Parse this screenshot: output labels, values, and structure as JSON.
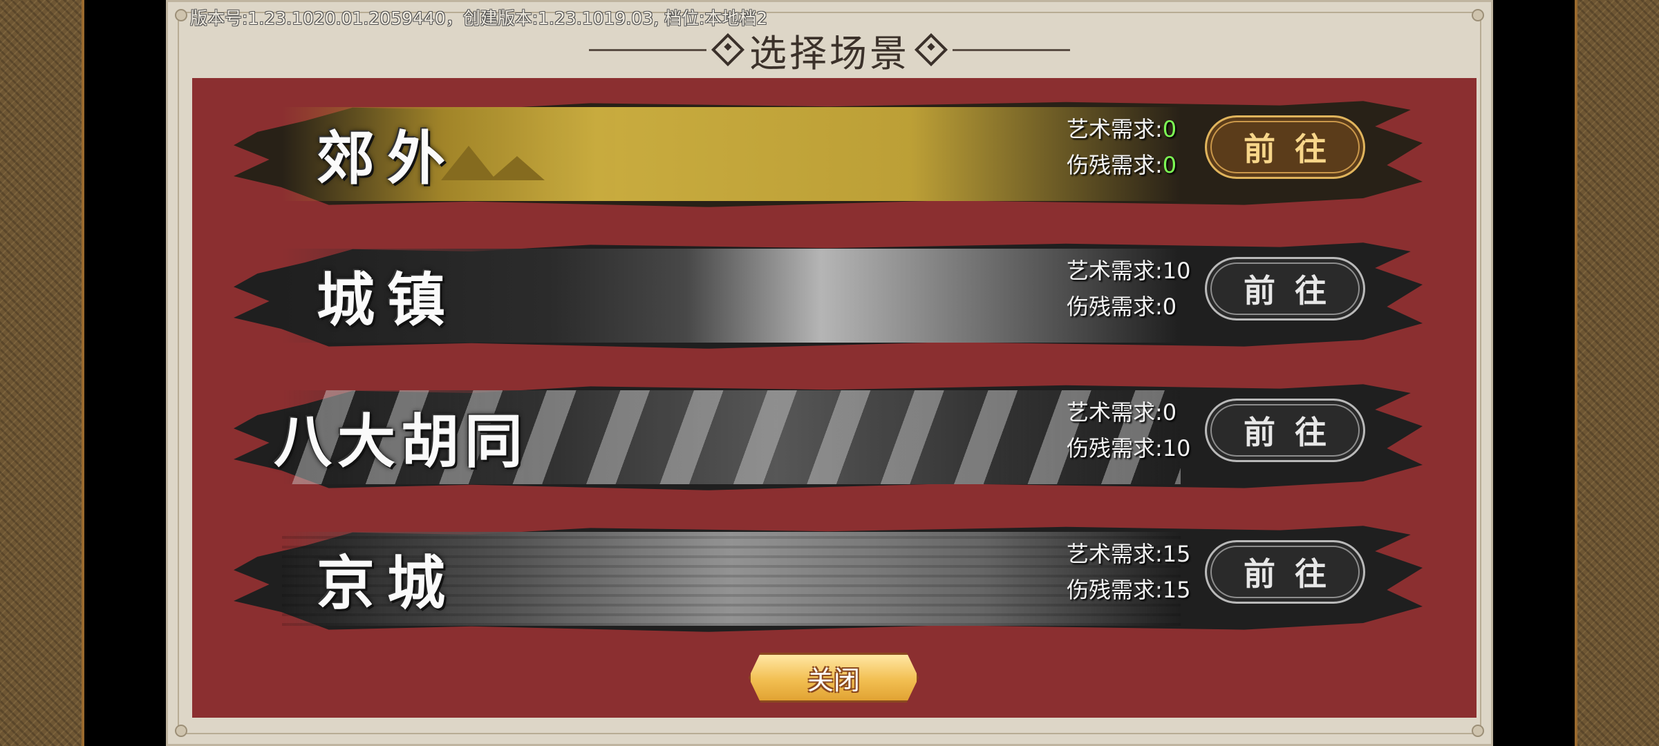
{
  "version_info": "版本号:1.23.1020.01.2059440，创建版本:1.23.1019.03, 档位:本地档2",
  "dialog": {
    "title": "选择场景",
    "close_label": "关闭"
  },
  "requirement_labels": {
    "art": "艺术需求:",
    "injury": "伤残需求:"
  },
  "scenes": [
    {
      "name": "郊外",
      "art_req": "0",
      "injury_req": "0",
      "go_label": "前往",
      "unlocked": true
    },
    {
      "name": "城镇",
      "art_req": "10",
      "injury_req": "0",
      "go_label": "前往",
      "unlocked": false
    },
    {
      "name": "八大胡同",
      "art_req": "0",
      "injury_req": "10",
      "go_label": "前往",
      "unlocked": false
    },
    {
      "name": "京城",
      "art_req": "15",
      "injury_req": "15",
      "go_label": "前往",
      "unlocked": false
    }
  ],
  "colors": {
    "panel_bg": "#ddd6c7",
    "red_area": "#8b2f30",
    "requirement_met": "#7dff54",
    "gold_button": "#e0b45c"
  }
}
